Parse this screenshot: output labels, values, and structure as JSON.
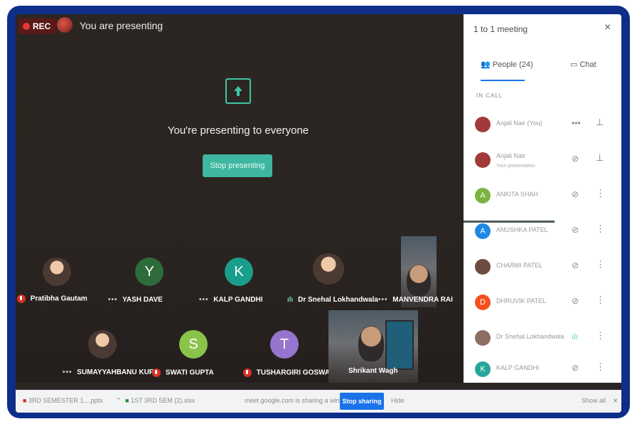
{
  "recording": {
    "label": "REC"
  },
  "presenter": {
    "status": "You are presenting"
  },
  "presenting": {
    "message": "You're presenting to everyone",
    "stop_button": "Stop presenting"
  },
  "tiles": [
    {
      "name": "Pratibha Gautam",
      "kind": "photo",
      "status": "muted"
    },
    {
      "name": "YASH DAVE",
      "initial": "Y",
      "color": "#2e6b3a",
      "status": "more"
    },
    {
      "name": "KALP GANDHI",
      "initial": "K",
      "color": "#1a9e8c",
      "status": "more"
    },
    {
      "name": "Dr Snehal Lokhandwala",
      "kind": "photo",
      "status": "speaking"
    },
    {
      "name": "MANVENDRA RAI",
      "kind": "video",
      "status": "more"
    },
    {
      "name": "SUMAYYAHBANU KUR...",
      "kind": "photo",
      "status": "more"
    },
    {
      "name": "SWATI GUPTA",
      "initial": "S",
      "color": "#8bc34a",
      "status": "muted"
    },
    {
      "name": "TUSHARGIRI GOSWAMI",
      "initial": "T",
      "color": "#9575cd",
      "status": "muted"
    },
    {
      "name": "Shrikant Wagh",
      "kind": "video",
      "status": "none"
    }
  ],
  "panel": {
    "title": "1 to 1 meeting",
    "close": "×",
    "tab_people": "People (24)",
    "tab_chat": "Chat",
    "section": "IN CALL",
    "people": [
      {
        "name": "Anjali Nair (You)",
        "sub": "",
        "initial": "",
        "color": "#a33a3a",
        "r1": "•••",
        "r2": "pin"
      },
      {
        "name": "Anjali Nair",
        "sub": "Your presentation",
        "initial": "",
        "color": "#a33a3a",
        "r1": "present",
        "r2": "pin"
      },
      {
        "name": "ANKITA SHAH",
        "sub": "",
        "initial": "A",
        "color": "#7cb342",
        "r1": "mic-off",
        "r2": "more"
      },
      {
        "name": "ANUSHKA PATEL",
        "sub": "",
        "initial": "A",
        "color": "#1e88e5",
        "r1": "mic-off",
        "r2": "more"
      },
      {
        "name": "CHARMI PATEL",
        "sub": "",
        "initial": "",
        "color": "#6d4c41",
        "r1": "mic-off",
        "r2": "more"
      },
      {
        "name": "DHRUVIK PATEL",
        "sub": "",
        "initial": "D",
        "color": "#f4511e",
        "r1": "mic-off",
        "r2": "more"
      },
      {
        "name": "Dr Snehal Lokhandwala",
        "sub": "",
        "initial": "",
        "color": "#8d6e63",
        "r1": "speaking",
        "r2": "more"
      },
      {
        "name": "KALP GANDHI",
        "sub": "",
        "initial": "K",
        "color": "#26a69a",
        "r1": "mic-off",
        "r2": "more"
      }
    ]
  },
  "bottombar": {
    "download1": "3RD SEMESTER 1....pptx",
    "download2": "1ST 3RD SEM (2).xlsx",
    "sharing_msg": "meet.google.com is sharing a window.",
    "stop_sharing": "Stop sharing",
    "hide": "Hide",
    "show_all": "Show all",
    "close": "×"
  },
  "colors": {
    "accent": "#3fb6a0",
    "blue": "#1a73e8",
    "frame": "#0d2f8a"
  }
}
